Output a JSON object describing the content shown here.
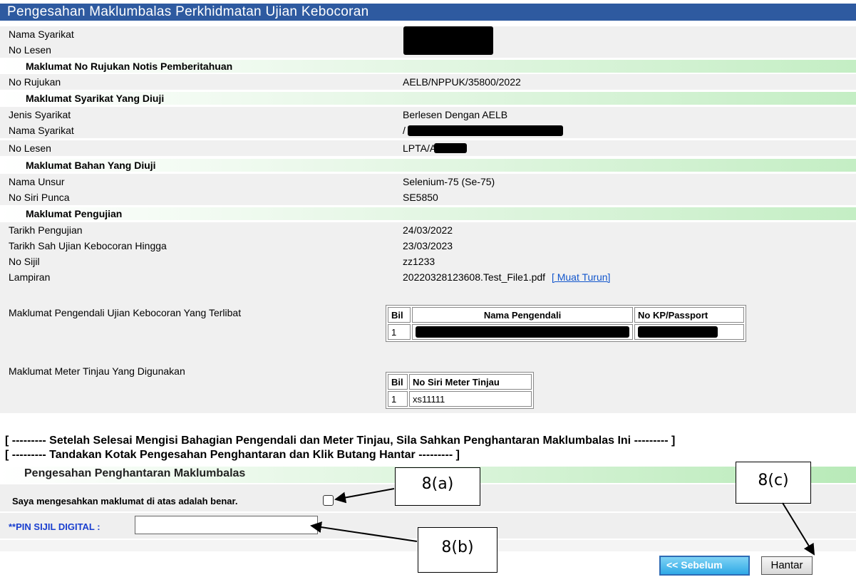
{
  "title": "Pengesahan Maklumbalas Perkhidmatan Ujian Kebocoran",
  "top_rows": [
    {
      "label": "Nama Syarikat"
    },
    {
      "label": "No Lesen"
    }
  ],
  "sections": {
    "notis": "Maklumat No Rujukan Notis Pemberitahuan",
    "syarikat": "Maklumat Syarikat Yang Diuji",
    "bahan": "Maklumat Bahan Yang Diuji",
    "pengujian": "Maklumat Pengujian"
  },
  "notis": {
    "no_rujukan_label": "No Rujukan",
    "no_rujukan_value": "AELB/NPPUK/35800/2022"
  },
  "syarikat": {
    "jenis_label": "Jenis Syarikat",
    "jenis_value": "Berlesen Dengan AELB",
    "nama_label": "Nama Syarikat",
    "nama_value_visible": "/",
    "lesen_label": "No Lesen",
    "lesen_value_visible": "LPTA/A/"
  },
  "bahan": {
    "unsur_label": "Nama Unsur",
    "unsur_value": "Selenium-75 (Se-75)",
    "siri_label": "No Siri Punca",
    "siri_value": "SE5850"
  },
  "pengujian": {
    "tarikh_label": "Tarikh Pengujian",
    "tarikh_value": "24/03/2022",
    "sah_label": "Tarikh Sah Ujian Kebocoran Hingga",
    "sah_value": "23/03/2023",
    "sijil_label": "No Sijil",
    "sijil_value": "zz1233",
    "lampiran_label": "Lampiran",
    "lampiran_file": "20220328123608.Test_File1.pdf",
    "lampiran_link": "[ Muat Turun]"
  },
  "pengendali": {
    "label": "Maklumat Pengendali Ujian Kebocoran Yang Terlibat",
    "headers": [
      "Bil",
      "Nama Pengendali",
      "No KP/Passport"
    ],
    "rows": [
      {
        "bil": "1"
      }
    ]
  },
  "meter": {
    "label": "Maklumat Meter Tinjau Yang Digunakan",
    "headers": [
      "Bil",
      "No Siri Meter Tinjau"
    ],
    "rows": [
      {
        "bil": "1",
        "no_siri": "xs11111"
      }
    ]
  },
  "notices": [
    "[ --------- Setelah Selesai Mengisi Bahagian Pengendali dan Meter Tinjau, Sila Sahkan Penghantaran Maklumbalas Ini --------- ]",
    "[ --------- Tandakan Kotak Pengesahan Penghantaran dan Klik Butang Hantar --------- ]"
  ],
  "confirm": {
    "section": "Pengesahan Penghantaran Maklumbalas",
    "checkbox_label": "Saya mengesahkan maklumat di atas adalah benar.",
    "checkbox_checked": false,
    "pin_label": "**PIN SIJIL DIGITAL :",
    "pin_value": ""
  },
  "callouts": {
    "a": "8(a)",
    "b": "8(b)",
    "c": "8(c)"
  },
  "buttons": {
    "prev": "<< Sebelum",
    "send": "Hantar"
  },
  "colors": {
    "title_bar": "#2e5aa0",
    "section_green": "#c4eec4",
    "pin_label": "#1a3fcf",
    "prev_button": "#2fa9e6"
  }
}
